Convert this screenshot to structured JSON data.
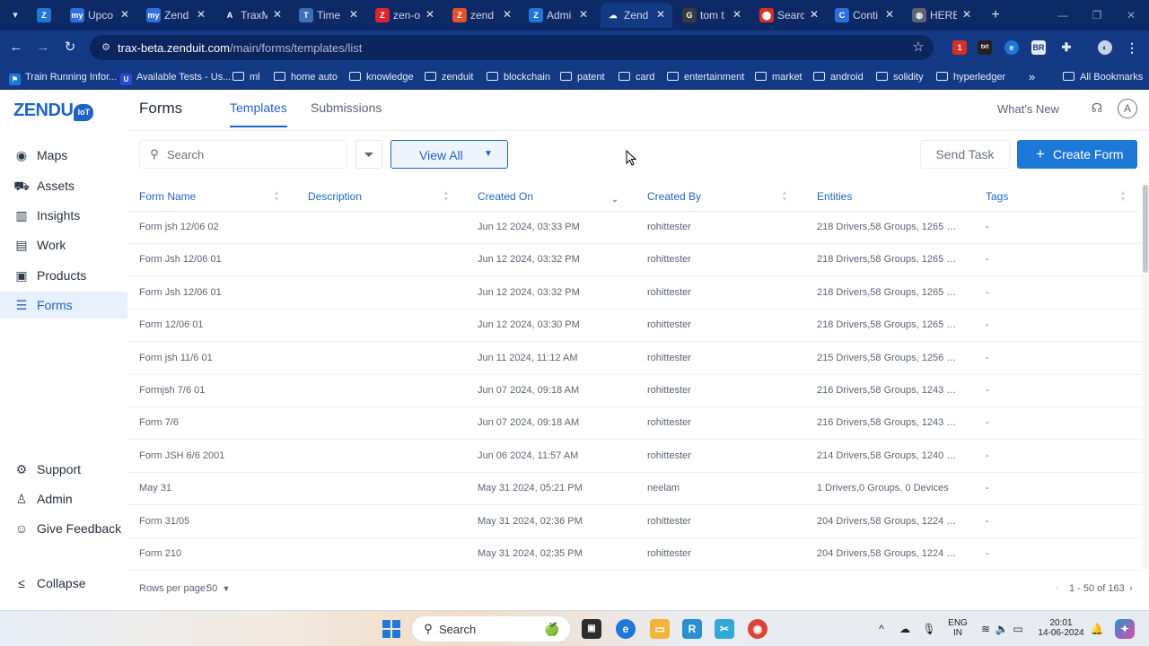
{
  "browser": {
    "tabs": [
      {
        "label": "",
        "icon": "zendu-icon",
        "color": "#1e78d8",
        "glyph": "Z"
      },
      {
        "label": "Upco",
        "icon": "my-icon",
        "color": "#2f6fdb",
        "glyph": "my"
      },
      {
        "label": "Zend",
        "icon": "my-icon",
        "color": "#2f6fdb",
        "glyph": "my"
      },
      {
        "label": "TraxM",
        "icon": "trax-icon",
        "color": "#0d2a66",
        "glyph": "A"
      },
      {
        "label": "Time",
        "icon": "time-icon",
        "color": "#3b6fb6",
        "glyph": "T"
      },
      {
        "label": "zen-o",
        "icon": "zen-icon",
        "color": "#d9262c",
        "glyph": "Z"
      },
      {
        "label": "zend",
        "icon": "zend-icon",
        "color": "#e0542c",
        "glyph": "Z"
      },
      {
        "label": "Admi",
        "icon": "zendu-icon",
        "color": "#1e78d8",
        "glyph": "Z"
      },
      {
        "label": "Zend",
        "icon": "cloud-icon",
        "color": "#153a85",
        "glyph": "☁"
      },
      {
        "label": "tom t",
        "icon": "google-icon",
        "color": "#3a3a3a",
        "glyph": "G"
      },
      {
        "label": "Searc",
        "icon": "maps-pin-icon",
        "color": "#d93025",
        "glyph": "⬤"
      },
      {
        "label": "Conti",
        "icon": "confluence-icon",
        "color": "#2f6fdb",
        "glyph": "C"
      },
      {
        "label": "HERE",
        "icon": "globe-icon",
        "color": "#5b6573",
        "glyph": "◍"
      }
    ],
    "url_host": "trax-beta.zenduit.com",
    "url_path": "/main/forms/templates/list",
    "extension_badge": "1",
    "ext_labels": {
      "txt": "txt",
      "br": "BR"
    },
    "bookmarks": [
      {
        "label": "Train Running Infor...",
        "type": "site",
        "color": "#1e78d8",
        "glyph": "⚑"
      },
      {
        "label": "Available Tests - Us...",
        "type": "site",
        "color": "#2f4ad0",
        "glyph": "U"
      },
      {
        "label": "ml",
        "type": "folder"
      },
      {
        "label": "home auto",
        "type": "folder"
      },
      {
        "label": "knowledge",
        "type": "folder"
      },
      {
        "label": "zenduit",
        "type": "folder"
      },
      {
        "label": "blockchain",
        "type": "folder"
      },
      {
        "label": "patent",
        "type": "folder"
      },
      {
        "label": "card",
        "type": "folder"
      },
      {
        "label": "entertainment",
        "type": "folder"
      },
      {
        "label": "market",
        "type": "folder"
      },
      {
        "label": "android",
        "type": "folder"
      },
      {
        "label": "solidity",
        "type": "folder"
      },
      {
        "label": "hyperledger",
        "type": "folder"
      }
    ],
    "more_bookmarks": "»",
    "all_bookmarks": "All Bookmarks"
  },
  "app": {
    "logo_text": "ZENDU",
    "logo_badge": "IoT",
    "nav": [
      {
        "label": "Maps",
        "icon": "map-pin-icon",
        "glyph": "◉"
      },
      {
        "label": "Assets",
        "icon": "truck-icon",
        "glyph": "⛟"
      },
      {
        "label": "Insights",
        "icon": "chart-icon",
        "glyph": "▥"
      },
      {
        "label": "Work",
        "icon": "briefcase-icon",
        "glyph": "▤"
      },
      {
        "label": "Products",
        "icon": "box-icon",
        "glyph": "▣"
      },
      {
        "label": "Forms",
        "icon": "form-icon",
        "glyph": "☰",
        "active": true
      }
    ],
    "nav_bottom": [
      {
        "label": "Support",
        "icon": "support-icon",
        "glyph": "⚙"
      },
      {
        "label": "Admin",
        "icon": "admin-icon",
        "glyph": "♙"
      },
      {
        "label": "Give Feedback",
        "icon": "feedback-icon",
        "glyph": "☺"
      }
    ],
    "collapse": {
      "label": "Collapse",
      "glyph": "≤"
    },
    "page_title": "Forms",
    "tabs": {
      "templates": "Templates",
      "submissions": "Submissions"
    },
    "whats_new": "What's New",
    "avatar_letter": "A"
  },
  "toolbar": {
    "search_placeholder": "Search",
    "view_all": "View All",
    "send_task": "Send Task",
    "create_form": "Create Form"
  },
  "table": {
    "columns": [
      "Form Name",
      "Description",
      "Created On",
      "Created By",
      "Entities",
      "Tags"
    ],
    "sorted_column": "Created On",
    "rows": [
      {
        "name": "Form jsh 12/06 02",
        "description": "",
        "created_on": "Jun 12 2024, 03:33 PM",
        "created_by": "rohittester",
        "entities": "218 Drivers,58 Groups, 1265 Devic...",
        "tags": "-"
      },
      {
        "name": "Form Jsh 12/06 01",
        "description": "",
        "created_on": "Jun 12 2024, 03:32 PM",
        "created_by": "rohittester",
        "entities": "218 Drivers,58 Groups, 1265 Devic...",
        "tags": "-"
      },
      {
        "name": "Form Jsh 12/06 01",
        "description": "",
        "created_on": "Jun 12 2024, 03:32 PM",
        "created_by": "rohittester",
        "entities": "218 Drivers,58 Groups, 1265 Devic...",
        "tags": "-"
      },
      {
        "name": "Form 12/06 01",
        "description": "",
        "created_on": "Jun 12 2024, 03:30 PM",
        "created_by": "rohittester",
        "entities": "218 Drivers,58 Groups, 1265 Devic...",
        "tags": "-"
      },
      {
        "name": "Form jsh 11/6 01",
        "description": "",
        "created_on": "Jun 11 2024, 11:12 AM",
        "created_by": "rohittester",
        "entities": "215 Drivers,58 Groups, 1256 Devic...",
        "tags": "-"
      },
      {
        "name": "Formjsh 7/6 01",
        "description": "",
        "created_on": "Jun 07 2024, 09:18 AM",
        "created_by": "rohittester",
        "entities": "216 Drivers,58 Groups, 1243 Devic...",
        "tags": "-"
      },
      {
        "name": "Form 7/6",
        "description": "",
        "created_on": "Jun 07 2024, 09:18 AM",
        "created_by": "rohittester",
        "entities": "216 Drivers,58 Groups, 1243 Devic...",
        "tags": "-"
      },
      {
        "name": "Form JSH 6/6 2001",
        "description": "",
        "created_on": "Jun 06 2024, 11:57 AM",
        "created_by": "rohittester",
        "entities": "214 Drivers,58 Groups, 1240 Devic...",
        "tags": "-"
      },
      {
        "name": "May 31",
        "description": "",
        "created_on": "May 31 2024, 05:21 PM",
        "created_by": "neelam",
        "entities": "1 Drivers,0 Groups, 0 Devices",
        "tags": "-"
      },
      {
        "name": "Form 31/05",
        "description": "",
        "created_on": "May 31 2024, 02:36 PM",
        "created_by": "rohittester",
        "entities": "204 Drivers,58 Groups, 1224 Devic...",
        "tags": "-"
      },
      {
        "name": "Form 210",
        "description": "",
        "created_on": "May 31 2024, 02:35 PM",
        "created_by": "rohittester",
        "entities": "204 Drivers,58 Groups, 1224 Devic...",
        "tags": "-"
      }
    ]
  },
  "pagination": {
    "rows_per_page_label": "Rows per page:",
    "rows_per_page": "50",
    "range": "1 - 50 of 163"
  },
  "taskbar": {
    "search_label": "Search",
    "lang_line1": "ENG",
    "lang_line2": "IN",
    "time": "20:01",
    "date": "14-06-2024"
  },
  "colors": {
    "accent": "#1e63c7",
    "primary_button": "#1e78d8",
    "browser_frame": "#153a85"
  }
}
